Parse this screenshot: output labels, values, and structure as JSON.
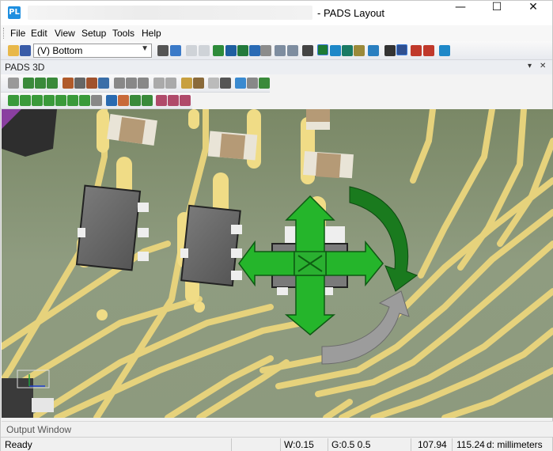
{
  "window": {
    "title": "- PADS Layout",
    "app_icon_glyph": "PL",
    "controls": {
      "minimize": "—",
      "maximize": "☐",
      "close": "✕"
    }
  },
  "menu": {
    "items": [
      "File",
      "Edit",
      "View",
      "Setup",
      "Tools",
      "Help"
    ]
  },
  "toolbar": {
    "layer_select_value": "(V) Bottom"
  },
  "panel": {
    "title": "PADS 3D",
    "pin": "▾",
    "close": "✕"
  },
  "output_window": {
    "label": "Output Window"
  },
  "status": {
    "ready": "Ready",
    "width": "W:0.15",
    "grid": "G:0.5 0.5",
    "x": "107.94",
    "y": "115.24",
    "units": "d: millimeters"
  },
  "colors": {
    "board": "#8a9a78",
    "trace": "#e8d27a",
    "pad_yellow": "#f2dc84",
    "chip_body": "#6b6b6b",
    "gizmo_green": "#22b52a",
    "gizmo_dark_green": "#176b1a",
    "gizmo_gray": "#9a9a9a"
  }
}
